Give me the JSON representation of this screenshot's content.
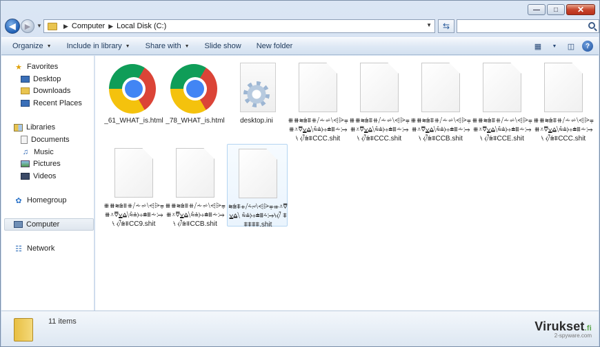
{
  "window": {
    "caption_buttons": {
      "minimize": "—",
      "maximize": "□",
      "close": "✕"
    }
  },
  "address": {
    "crumbs": [
      "Computer",
      "Local Disk (C:)"
    ],
    "refresh_glyph": "⇆"
  },
  "toolbar": {
    "items": [
      "Organize",
      "Include in library",
      "Share with",
      "Slide show",
      "New folder"
    ],
    "caret": "▼"
  },
  "navpane": {
    "favorites_label": "Favorites",
    "favorites": [
      "Desktop",
      "Downloads",
      "Recent Places"
    ],
    "libraries_label": "Libraries",
    "libraries": [
      "Documents",
      "Music",
      "Pictures",
      "Videos"
    ],
    "homegroup": "Homegroup",
    "computer": "Computer",
    "network": "Network"
  },
  "files": [
    {
      "name": "_61_WHAT_is.html",
      "icon": "chrome-icon"
    },
    {
      "name": "_78_WHAT_is.html",
      "icon": "chrome-icon"
    },
    {
      "name": "desktop.ini",
      "icon": "settings-file-icon"
    },
    {
      "name": "⧻⧻⩬⩭⩨⧺⧸⩪⩫⧵⩤⩥⩦⧻⩡⩢⩣⩠⧹⩯⩮⧽⧾⩧⩩⩪⧴⧷ ⧼⧶⩭⩨CCC.shit",
      "icon": "blank-file-icon"
    },
    {
      "name": "⧻⧻⩬⩭⩨⧺⧸⩪⩫⧵⩤⩥⩦⧻⩡⩢⩣⩠⧹⩯⩮⧽⧾⩧⩩⩪⧴⧷ ⧼⧶⩭⩨CCC.shit",
      "icon": "blank-file-icon"
    },
    {
      "name": "⧻⧻⩬⩭⩨⧺⧸⩪⩫⧵⩤⩥⩦⧻⩡⩢⩣⩠⧹⩯⩮⧽⧾⩧⩩⩪⧴⧷ ⧼⧶⩭⩨CCB.shit",
      "icon": "blank-file-icon"
    },
    {
      "name": "⧻⧻⩬⩭⩨⧺⧸⩪⩫⧵⩤⩥⩦⧻⩡⩢⩣⩠⧹⩯⩮⧽⧾⩧⩩⩪⧴⧷ ⧼⧶⩭⩨CCE.shit",
      "icon": "blank-file-icon"
    },
    {
      "name": "⧻⧻⩬⩭⩨⧺⧸⩪⩫⧵⩤⩥⩦⧻⩡⩢⩣⩠⧹⩯⩮⧽⧾⩧⩩⩪⧴⧷ ⧼⧶⩭⩨CCC.shit",
      "icon": "blank-file-icon"
    },
    {
      "name": "⧻⧻⩬⩭⩨⧺⧸⩪⩫⧵⩤⩥⩦⧻⩡⩢⩣⩠⧹⩯⩮⧽⧾⩧⩩⩪⧴⧷ ⧼⧶⩭⩨CC9.shit",
      "icon": "blank-file-icon"
    },
    {
      "name": "⧻⧻⩬⩭⩨⧺⧸⩪⩫⧵⩤⩥⩦⧻⩡⩢⩣⩠⧹⩯⩮⧽⧾⩧⩩⩪⧴⧷ ⧼⧶⩭⩨CCB.shit",
      "icon": "blank-file-icon"
    },
    {
      "name": "⩬⩭⩨⧺⧸⩪⩫⧵⩤⩥⩦⧻⩡⩢⩣⩠⧹ ⩯⩮⧽⧾⩧⩩⩪⧴⧷⧼⧶ ⩨⩨⩨⩨⩨.shit",
      "icon": "blank-file-icon",
      "selected": true
    }
  ],
  "status": {
    "count": "11 items"
  },
  "watermark": {
    "brand": "Virukset",
    "tld": ".fi",
    "sub": "2-spyware.com"
  }
}
